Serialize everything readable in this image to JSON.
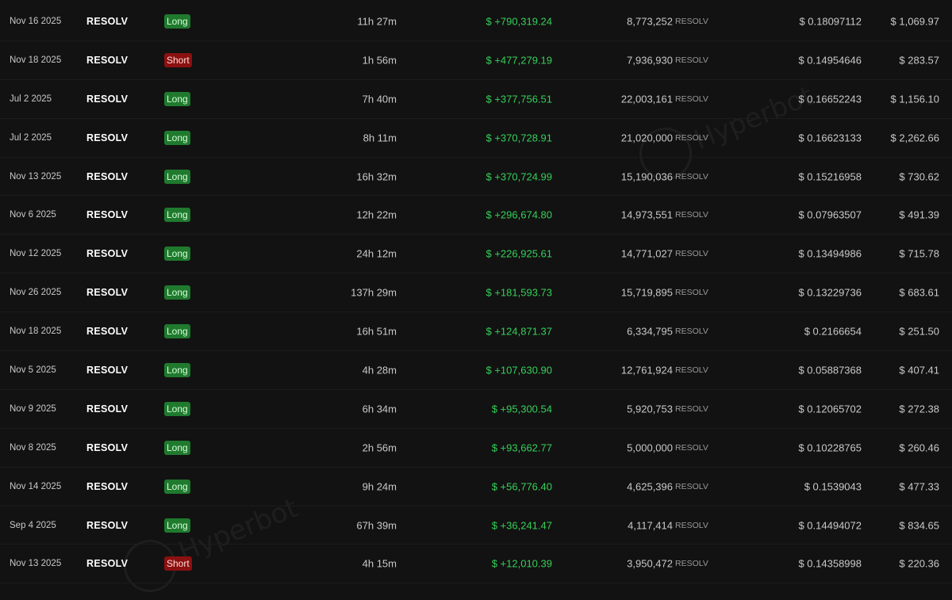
{
  "watermark": "Hyperbot",
  "unit_label": "RESOLV",
  "colors": {
    "background": "#121212",
    "long_badge": "#1f7a2e",
    "short_badge": "#8b1010",
    "pnl_positive": "#35d058"
  },
  "trades": [
    {
      "date": "Nov 16 2025",
      "token": "RESOLV",
      "side": "Long",
      "duration": "11h 27m",
      "pnl": "$ +790,319.24",
      "size": "8,773,252",
      "unit": "RESOLV",
      "price": "$ 0.18097112",
      "fee": "$ 1,069.97"
    },
    {
      "date": "Nov 18 2025",
      "token": "RESOLV",
      "side": "Short",
      "duration": "1h 56m",
      "pnl": "$ +477,279.19",
      "size": "7,936,930",
      "unit": "RESOLV",
      "price": "$ 0.14954646",
      "fee": "$ 283.57"
    },
    {
      "date": "Jul 2 2025",
      "token": "RESOLV",
      "side": "Long",
      "duration": "7h 40m",
      "pnl": "$ +377,756.51",
      "size": "22,003,161",
      "unit": "RESOLV",
      "price": "$ 0.16652243",
      "fee": "$ 1,156.10"
    },
    {
      "date": "Jul 2 2025",
      "token": "RESOLV",
      "side": "Long",
      "duration": "8h 11m",
      "pnl": "$ +370,728.91",
      "size": "21,020,000",
      "unit": "RESOLV",
      "price": "$ 0.16623133",
      "fee": "$ 2,262.66"
    },
    {
      "date": "Nov 13 2025",
      "token": "RESOLV",
      "side": "Long",
      "duration": "16h 32m",
      "pnl": "$ +370,724.99",
      "size": "15,190,036",
      "unit": "RESOLV",
      "price": "$ 0.15216958",
      "fee": "$ 730.62"
    },
    {
      "date": "Nov 6 2025",
      "token": "RESOLV",
      "side": "Long",
      "duration": "12h 22m",
      "pnl": "$ +296,674.80",
      "size": "14,973,551",
      "unit": "RESOLV",
      "price": "$ 0.07963507",
      "fee": "$ 491.39"
    },
    {
      "date": "Nov 12 2025",
      "token": "RESOLV",
      "side": "Long",
      "duration": "24h 12m",
      "pnl": "$ +226,925.61",
      "size": "14,771,027",
      "unit": "RESOLV",
      "price": "$ 0.13494986",
      "fee": "$ 715.78"
    },
    {
      "date": "Nov 26 2025",
      "token": "RESOLV",
      "side": "Long",
      "duration": "137h 29m",
      "pnl": "$ +181,593.73",
      "size": "15,719,895",
      "unit": "RESOLV",
      "price": "$ 0.13229736",
      "fee": "$ 683.61"
    },
    {
      "date": "Nov 18 2025",
      "token": "RESOLV",
      "side": "Long",
      "duration": "16h 51m",
      "pnl": "$ +124,871.37",
      "size": "6,334,795",
      "unit": "RESOLV",
      "price": "$ 0.2166654",
      "fee": "$ 251.50"
    },
    {
      "date": "Nov 5 2025",
      "token": "RESOLV",
      "side": "Long",
      "duration": "4h 28m",
      "pnl": "$ +107,630.90",
      "size": "12,761,924",
      "unit": "RESOLV",
      "price": "$ 0.05887368",
      "fee": "$ 407.41"
    },
    {
      "date": "Nov 9 2025",
      "token": "RESOLV",
      "side": "Long",
      "duration": "6h 34m",
      "pnl": "$ +95,300.54",
      "size": "5,920,753",
      "unit": "RESOLV",
      "price": "$ 0.12065702",
      "fee": "$ 272.38"
    },
    {
      "date": "Nov 8 2025",
      "token": "RESOLV",
      "side": "Long",
      "duration": "2h 56m",
      "pnl": "$ +93,662.77",
      "size": "5,000,000",
      "unit": "RESOLV",
      "price": "$ 0.10228765",
      "fee": "$ 260.46"
    },
    {
      "date": "Nov 14 2025",
      "token": "RESOLV",
      "side": "Long",
      "duration": "9h 24m",
      "pnl": "$ +56,776.40",
      "size": "4,625,396",
      "unit": "RESOLV",
      "price": "$ 0.1539043",
      "fee": "$ 477.33"
    },
    {
      "date": "Sep 4 2025",
      "token": "RESOLV",
      "side": "Long",
      "duration": "67h 39m",
      "pnl": "$ +36,241.47",
      "size": "4,117,414",
      "unit": "RESOLV",
      "price": "$ 0.14494072",
      "fee": "$ 834.65"
    },
    {
      "date": "Nov 13 2025",
      "token": "RESOLV",
      "side": "Short",
      "duration": "4h 15m",
      "pnl": "$ +12,010.39",
      "size": "3,950,472",
      "unit": "RESOLV",
      "price": "$ 0.14358998",
      "fee": "$ 220.36"
    }
  ]
}
